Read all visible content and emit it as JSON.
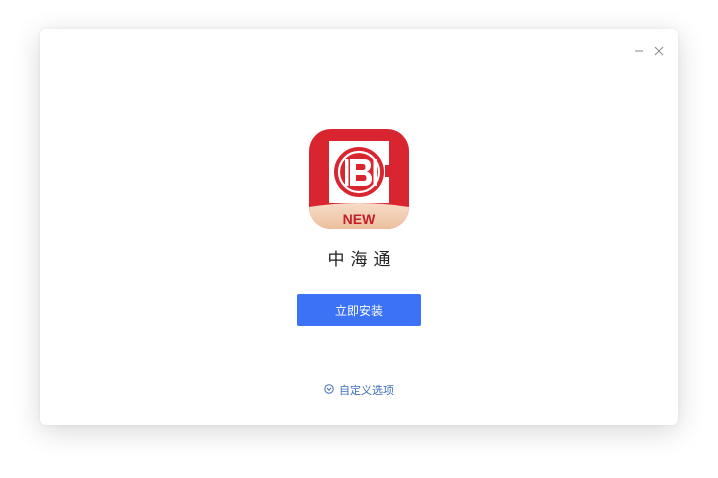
{
  "window": {
    "minimize_icon": "minimize-icon",
    "close_icon": "close-icon"
  },
  "app": {
    "icon_name": "app-logo-icon",
    "icon_badge": "NEW",
    "name": "中海通"
  },
  "actions": {
    "install_label": "立即安装",
    "custom_options_label": "自定义选项",
    "custom_options_icon": "chevron-down-circle-icon"
  },
  "colors": {
    "accent": "#3b72f6",
    "link": "#3f6fb7",
    "brand_red": "#d9252f"
  }
}
